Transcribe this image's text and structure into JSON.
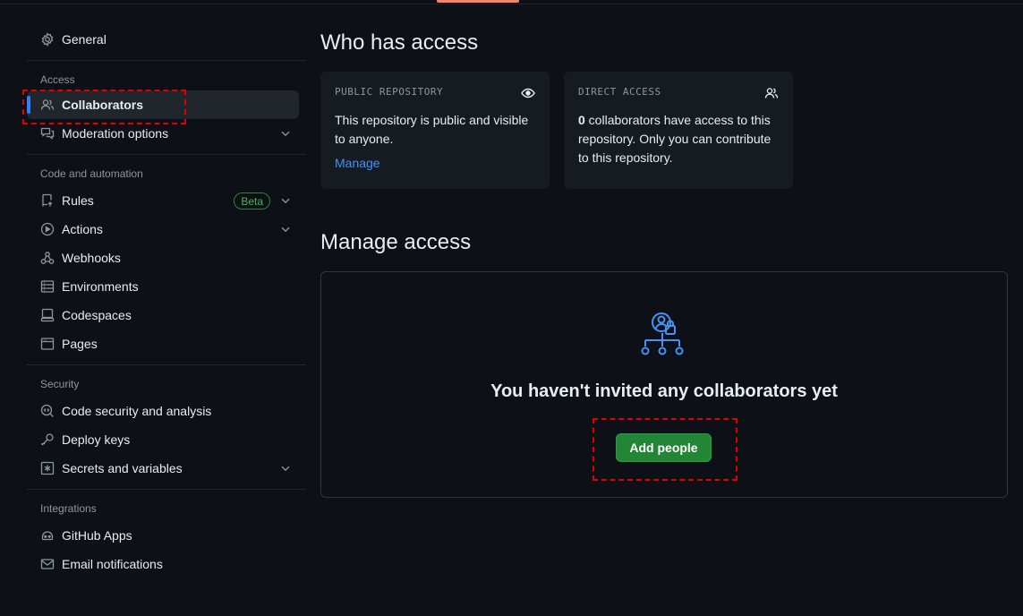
{
  "sidebar": {
    "general": {
      "label": "General",
      "icon": "gear-icon"
    },
    "access": {
      "title": "Access",
      "items": [
        {
          "label": "Collaborators",
          "icon": "people-icon",
          "selected": true
        },
        {
          "label": "Moderation options",
          "icon": "comment-discussion-icon"
        }
      ]
    },
    "code_automation": {
      "title": "Code and automation",
      "items": [
        {
          "label": "Rules",
          "icon": "rules-icon",
          "badge": "Beta"
        },
        {
          "label": "Actions",
          "icon": "play-icon"
        },
        {
          "label": "Webhooks",
          "icon": "webhook-icon"
        },
        {
          "label": "Environments",
          "icon": "server-icon"
        },
        {
          "label": "Codespaces",
          "icon": "codespaces-icon"
        },
        {
          "label": "Pages",
          "icon": "browser-icon"
        }
      ]
    },
    "security": {
      "title": "Security",
      "items": [
        {
          "label": "Code security and analysis",
          "icon": "codescan-icon"
        },
        {
          "label": "Deploy keys",
          "icon": "key-icon"
        },
        {
          "label": "Secrets and variables",
          "icon": "asterisk-icon"
        }
      ]
    },
    "integrations": {
      "title": "Integrations",
      "items": [
        {
          "label": "GitHub Apps",
          "icon": "apps-icon"
        },
        {
          "label": "Email notifications",
          "icon": "mail-icon"
        }
      ]
    }
  },
  "who_has_access": {
    "title": "Who has access",
    "public_card": {
      "kicker": "PUBLIC REPOSITORY",
      "body": "This repository is public and visible to anyone.",
      "link": "Manage",
      "icon": "eye-icon"
    },
    "direct_card": {
      "kicker": "DIRECT ACCESS",
      "count": "0",
      "body": " collaborators have access to this repository. Only you can contribute to this repository.",
      "icon": "people-icon"
    }
  },
  "manage_access": {
    "title": "Manage access",
    "empty_title": "You haven't invited any collaborators yet",
    "button": "Add people",
    "icon": "org-lock-icon"
  },
  "colors": {
    "background": "#0d1117",
    "accent_blue": "#2f81f7",
    "button_green": "#238636",
    "highlight_red": "#e00000"
  }
}
